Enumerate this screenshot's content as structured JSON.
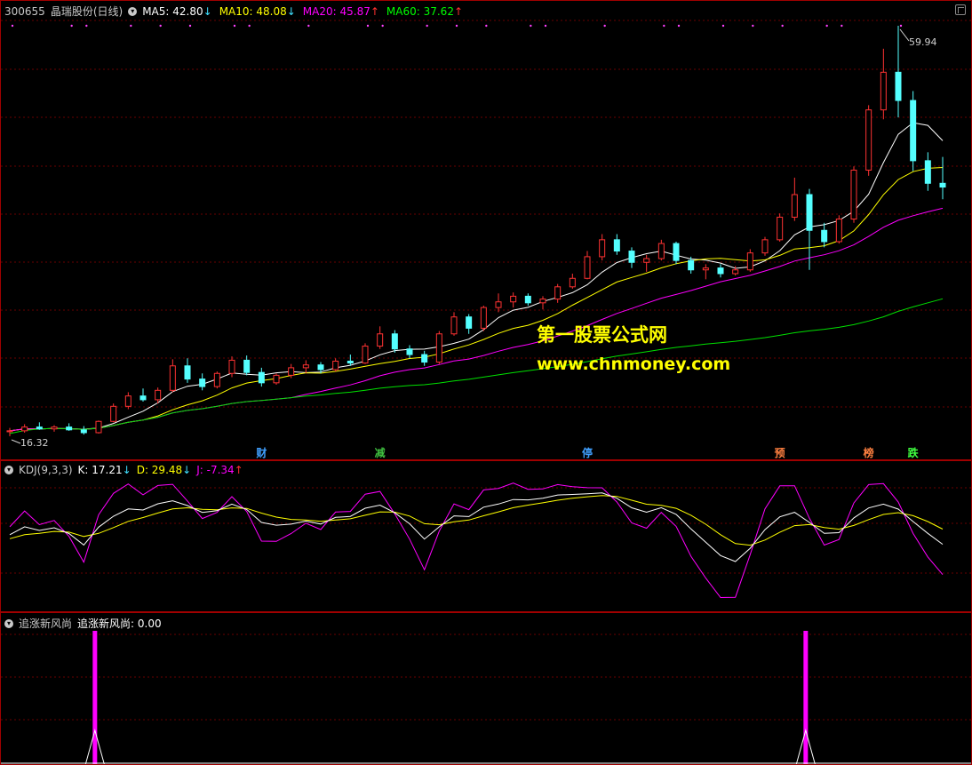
{
  "header": {
    "code": "300655",
    "name": "晶瑞股份",
    "period": "(日线)",
    "ma": [
      {
        "label": "MA5: 42.80",
        "color": "#ffffff",
        "arrow": "↓",
        "arrow_color": "#40e0ff"
      },
      {
        "label": "MA10: 48.08",
        "color": "#ffff00",
        "arrow": "↓",
        "arrow_color": "#40e0ff"
      },
      {
        "label": "MA20: 45.87",
        "color": "#ff00ff",
        "arrow": "↑",
        "arrow_color": "#ff3030"
      },
      {
        "label": "MA60: 37.62",
        "color": "#00ff00",
        "arrow": "↑",
        "arrow_color": "#ff3030"
      }
    ]
  },
  "price_labels": {
    "high": "59.94",
    "low": "16.32"
  },
  "events": [
    {
      "text": "财",
      "color": "#40a0ff",
      "index": 17
    },
    {
      "text": "减",
      "color": "#40c040",
      "index": 25
    },
    {
      "text": "停",
      "color": "#40a0ff",
      "index": 39
    },
    {
      "text": "预",
      "color": "#ff8040",
      "index": 52
    },
    {
      "text": "榜",
      "color": "#ff8040",
      "index": 58
    },
    {
      "text": "跌",
      "color": "#40ff40",
      "index": 61
    }
  ],
  "kdj": {
    "title": "KDJ(9,3,3)",
    "k": "K: 17.21",
    "k_arrow": "↓",
    "d": "D: 29.48",
    "d_arrow": "↓",
    "j": "J: -7.34",
    "j_arrow": "↑"
  },
  "indicator": {
    "title": "追涨新风尚",
    "value": "追涨新风尚: 0.00",
    "bars": [
      5,
      53
    ]
  },
  "watermark": {
    "line1": "第一股票公式网",
    "line2": "www.chnmoney.com"
  },
  "chart_data": {
    "type": "candlestick",
    "series_points": 64,
    "ohlc": [
      [
        16.8,
        17.2,
        16.32,
        16.9
      ],
      [
        16.9,
        17.6,
        16.7,
        17.3
      ],
      [
        17.3,
        17.8,
        17.0,
        17.1
      ],
      [
        17.1,
        17.5,
        16.8,
        17.3
      ],
      [
        17.3,
        17.7,
        16.9,
        17.0
      ],
      [
        17.0,
        17.4,
        16.5,
        16.7
      ],
      [
        16.7,
        18.0,
        16.6,
        17.9
      ],
      [
        17.9,
        19.8,
        17.8,
        19.5
      ],
      [
        19.5,
        21.0,
        19.2,
        20.6
      ],
      [
        20.6,
        21.4,
        20.0,
        20.2
      ],
      [
        20.2,
        21.5,
        19.8,
        21.2
      ],
      [
        21.2,
        24.5,
        21.0,
        23.8
      ],
      [
        23.8,
        24.6,
        22.0,
        22.4
      ],
      [
        22.4,
        23.0,
        21.2,
        21.6
      ],
      [
        21.6,
        23.2,
        21.4,
        23.0
      ],
      [
        23.0,
        24.8,
        22.6,
        24.4
      ],
      [
        24.4,
        24.9,
        22.8,
        23.1
      ],
      [
        23.1,
        23.6,
        21.6,
        22.0
      ],
      [
        22.0,
        23.0,
        21.8,
        22.8
      ],
      [
        22.8,
        24.0,
        22.5,
        23.6
      ],
      [
        23.6,
        24.4,
        23.0,
        23.9
      ],
      [
        23.9,
        24.2,
        23.0,
        23.4
      ],
      [
        23.4,
        24.6,
        23.2,
        24.3
      ],
      [
        24.3,
        25.0,
        23.8,
        24.1
      ],
      [
        24.1,
        26.2,
        24.0,
        25.9
      ],
      [
        25.9,
        28.0,
        25.6,
        27.2
      ],
      [
        27.2,
        27.6,
        25.2,
        25.6
      ],
      [
        25.6,
        26.0,
        24.6,
        25.0
      ],
      [
        25.0,
        25.4,
        23.8,
        24.2
      ],
      [
        24.2,
        27.5,
        24.0,
        27.2
      ],
      [
        27.2,
        29.5,
        27.0,
        29.0
      ],
      [
        29.0,
        29.3,
        27.2,
        27.8
      ],
      [
        27.8,
        30.2,
        27.5,
        30.0
      ],
      [
        30.0,
        31.5,
        29.5,
        30.6
      ],
      [
        30.6,
        31.6,
        30.0,
        31.2
      ],
      [
        31.2,
        31.5,
        30.2,
        30.5
      ],
      [
        30.5,
        31.2,
        29.8,
        30.9
      ],
      [
        30.9,
        32.5,
        30.5,
        32.2
      ],
      [
        32.2,
        33.6,
        32.0,
        33.1
      ],
      [
        33.1,
        36.0,
        33.0,
        35.4
      ],
      [
        35.4,
        37.8,
        35.0,
        37.2
      ],
      [
        37.2,
        37.8,
        35.6,
        36.0
      ],
      [
        36.0,
        36.4,
        34.2,
        34.8
      ],
      [
        34.8,
        35.6,
        33.8,
        35.2
      ],
      [
        35.2,
        37.2,
        35.0,
        36.8
      ],
      [
        36.8,
        37.0,
        34.6,
        35.0
      ],
      [
        35.0,
        35.4,
        33.6,
        34.0
      ],
      [
        34.0,
        34.6,
        33.0,
        34.2
      ],
      [
        34.2,
        34.6,
        33.2,
        33.6
      ],
      [
        33.6,
        34.4,
        33.4,
        34.0
      ],
      [
        34.0,
        36.2,
        33.8,
        35.8
      ],
      [
        35.8,
        37.5,
        35.5,
        37.2
      ],
      [
        37.2,
        40.0,
        37.0,
        39.6
      ],
      [
        39.6,
        43.8,
        39.2,
        42.0
      ],
      [
        42.0,
        42.6,
        34.0,
        38.2
      ],
      [
        38.2,
        39.0,
        36.4,
        37.0
      ],
      [
        37.0,
        39.8,
        36.8,
        39.4
      ],
      [
        39.4,
        45.0,
        39.0,
        44.6
      ],
      [
        44.6,
        51.5,
        44.0,
        51.0
      ],
      [
        51.0,
        57.5,
        50.0,
        55.0
      ],
      [
        55.0,
        59.94,
        50.2,
        52.0
      ],
      [
        52.0,
        53.0,
        44.5,
        45.6
      ],
      [
        45.6,
        46.5,
        42.4,
        43.2
      ],
      [
        43.2,
        46.0,
        41.5,
        42.8
      ]
    ],
    "ma_periods": [
      5,
      10,
      20,
      60
    ],
    "ylim": [
      16.32,
      59.94
    ],
    "kdj_ylim": [
      -10,
      110
    ]
  }
}
